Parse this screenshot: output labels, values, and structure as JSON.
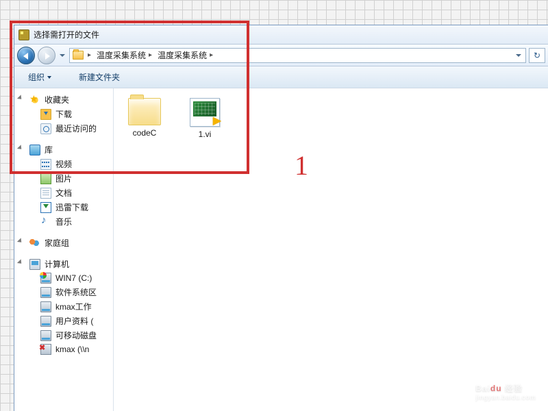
{
  "window": {
    "title": "选择需打开的文件"
  },
  "breadcrumb": {
    "seg1": "温度采集系统",
    "seg2": "温度采集系统"
  },
  "toolbar": {
    "organize": "组织",
    "newfolder": "新建文件夹"
  },
  "sidebar": {
    "favorites": {
      "header": "收藏夹",
      "items": [
        "下载",
        "最近访问的"
      ]
    },
    "libraries": {
      "header": "库",
      "items": [
        "视频",
        "图片",
        "文档",
        "迅雷下载",
        "音乐"
      ]
    },
    "homegroup": {
      "header": "家庭组"
    },
    "computer": {
      "header": "计算机",
      "items": [
        "WIN7 (C:)",
        "软件系统区",
        "kmax工作",
        "用户资料 (",
        "可移动磁盘",
        "kmax (\\\\n"
      ]
    }
  },
  "files": {
    "folder1": "codeC",
    "file1": "1.vi"
  },
  "annotation": {
    "number": "1"
  },
  "watermark": {
    "brand_a": "Bai",
    "brand_b": "du",
    "brand_c": "经验",
    "sub": "jingyan.baidu.com"
  }
}
